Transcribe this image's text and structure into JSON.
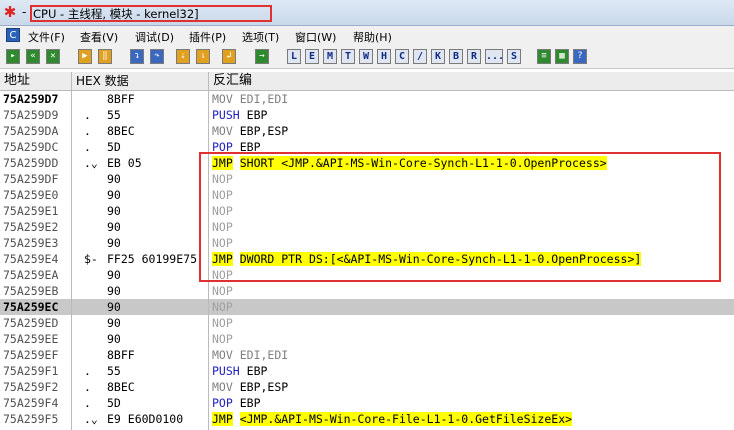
{
  "window": {
    "title_prefix": "-",
    "title": "CPU - 主线程, 模块 - kernel32]"
  },
  "menu": [
    {
      "label": "文件(F)"
    },
    {
      "label": "查看(V)"
    },
    {
      "label": "调试(D)"
    },
    {
      "label": "插件(P)"
    },
    {
      "label": "选项(T)"
    },
    {
      "label": "窗口(W)"
    },
    {
      "label": "帮助(H)"
    }
  ],
  "menu_c": "C",
  "toolbar": {
    "letters": [
      "L",
      "E",
      "M",
      "T",
      "W",
      "H",
      "C",
      "/",
      "K",
      "B",
      "R",
      "...",
      "S"
    ]
  },
  "columns": {
    "addr": "地址",
    "hex": "HEX 数据",
    "disasm": "反汇编"
  },
  "rows": [
    {
      "addr": "75A259D7",
      "mark": "",
      "hex": "8BFF",
      "op": "MOV",
      "args": "EDI,EDI",
      "kind": "mov",
      "bold": true
    },
    {
      "addr": "75A259D9",
      "mark": ".",
      "hex": "55",
      "op": "PUSH",
      "args": "EBP",
      "kind": "push"
    },
    {
      "addr": "75A259DA",
      "mark": ".",
      "hex": "8BEC",
      "op": "MOV",
      "args": "EBP,ESP",
      "kind": "mov2"
    },
    {
      "addr": "75A259DC",
      "mark": ".",
      "hex": "5D",
      "op": "POP",
      "args": "EBP",
      "kind": "pop"
    },
    {
      "addr": "75A259DD",
      "mark": ".⌄",
      "hex": "EB 05",
      "op": "JMP",
      "args": "SHORT <JMP.&API-MS-Win-Core-Synch-L1-1-0.OpenProcess>",
      "kind": "jmp"
    },
    {
      "addr": "75A259DF",
      "mark": "",
      "hex": "90",
      "op": "NOP",
      "args": "",
      "kind": "nop"
    },
    {
      "addr": "75A259E0",
      "mark": "",
      "hex": "90",
      "op": "NOP",
      "args": "",
      "kind": "nop"
    },
    {
      "addr": "75A259E1",
      "mark": "",
      "hex": "90",
      "op": "NOP",
      "args": "",
      "kind": "nop"
    },
    {
      "addr": "75A259E2",
      "mark": "",
      "hex": "90",
      "op": "NOP",
      "args": "",
      "kind": "nop"
    },
    {
      "addr": "75A259E3",
      "mark": "",
      "hex": "90",
      "op": "NOP",
      "args": "",
      "kind": "nop"
    },
    {
      "addr": "75A259E4",
      "mark": "$-",
      "hex": "FF25 60199E75",
      "op": "JMP",
      "args": "DWORD PTR DS:[<&API-MS-Win-Core-Synch-L1-1-0.OpenProcess>]",
      "kind": "jmp"
    },
    {
      "addr": "75A259EA",
      "mark": "",
      "hex": "90",
      "op": "NOP",
      "args": "",
      "kind": "nop"
    },
    {
      "addr": "75A259EB",
      "mark": "",
      "hex": "90",
      "op": "NOP",
      "args": "",
      "kind": "nop"
    },
    {
      "addr": "75A259EC",
      "mark": "",
      "hex": "90",
      "op": "NOP",
      "args": "",
      "kind": "nop",
      "bold": true,
      "selected": true
    },
    {
      "addr": "75A259ED",
      "mark": "",
      "hex": "90",
      "op": "NOP",
      "args": "",
      "kind": "nop"
    },
    {
      "addr": "75A259EE",
      "mark": "",
      "hex": "90",
      "op": "NOP",
      "args": "",
      "kind": "nop"
    },
    {
      "addr": "75A259EF",
      "mark": "",
      "hex": "8BFF",
      "op": "MOV",
      "args": "EDI,EDI",
      "kind": "mov"
    },
    {
      "addr": "75A259F1",
      "mark": ".",
      "hex": "55",
      "op": "PUSH",
      "args": "EBP",
      "kind": "push"
    },
    {
      "addr": "75A259F2",
      "mark": ".",
      "hex": "8BEC",
      "op": "MOV",
      "args": "EBP,ESP",
      "kind": "mov2"
    },
    {
      "addr": "75A259F4",
      "mark": ".",
      "hex": "5D",
      "op": "POP",
      "args": "EBP",
      "kind": "pop"
    },
    {
      "addr": "75A259F5",
      "mark": ".⌄",
      "hex": "E9 E60D0100",
      "op": "JMP",
      "args": "<JMP.&API-MS-Win-Core-File-L1-1-0.GetFileSizeEx>",
      "kind": "jmp2"
    }
  ]
}
